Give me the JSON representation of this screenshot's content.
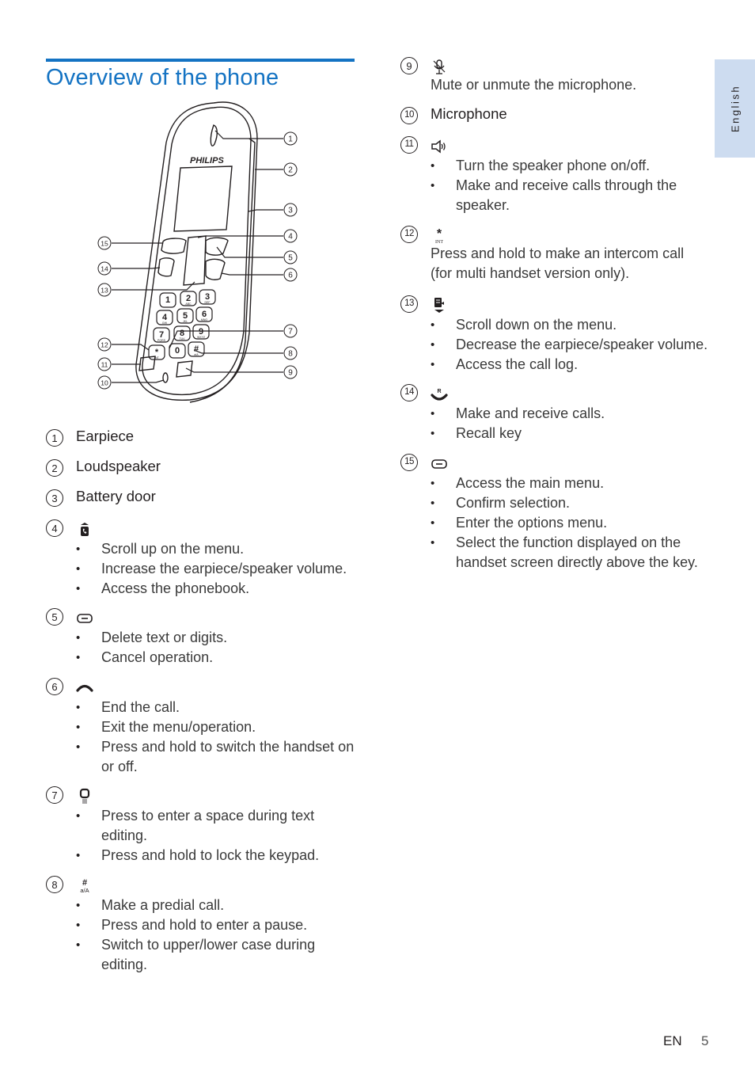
{
  "page": {
    "title": "Overview of the phone",
    "language_tab": "English",
    "footer_lang": "EN",
    "footer_page": "5",
    "accent_color": "#1473c3",
    "tab_color": "#cddcf0"
  },
  "diagram": {
    "brand": "PHILIPS",
    "callouts": [
      "1",
      "2",
      "3",
      "4",
      "5",
      "6",
      "7",
      "8",
      "9",
      "10",
      "11",
      "12",
      "13",
      "14",
      "15"
    ],
    "keypad": [
      {
        "digit": "1",
        "sub": ""
      },
      {
        "digit": "2",
        "sub": "ABC"
      },
      {
        "digit": "3",
        "sub": "DEF"
      },
      {
        "digit": "4",
        "sub": "GHI"
      },
      {
        "digit": "5",
        "sub": "JKL"
      },
      {
        "digit": "6",
        "sub": "MNO"
      },
      {
        "digit": "7",
        "sub": "PQRS"
      },
      {
        "digit": "8",
        "sub": "TUV"
      },
      {
        "digit": "9",
        "sub": "WXYZ"
      },
      {
        "digit": "*",
        "sub": "INT"
      },
      {
        "digit": "0",
        "sub": ""
      },
      {
        "digit": "#",
        "sub": "a/A"
      }
    ]
  },
  "items": [
    {
      "num": "1",
      "label": "Earpiece"
    },
    {
      "num": "2",
      "label": "Loudspeaker"
    },
    {
      "num": "3",
      "label": "Battery door"
    },
    {
      "num": "4",
      "icon": "scroll-up-phonebook-icon",
      "bullets": [
        "Scroll up on the menu.",
        "Increase the earpiece/speaker volume.",
        "Access the phonebook."
      ]
    },
    {
      "num": "5",
      "icon": "soft-key-icon",
      "bullets": [
        "Delete text or digits.",
        "Cancel operation."
      ]
    },
    {
      "num": "6",
      "icon": "end-call-icon",
      "bullets": [
        "End the call.",
        "Exit the menu/operation.",
        "Press and hold to switch the handset on or off."
      ]
    },
    {
      "num": "7",
      "icon": "zero-space-key-icon",
      "bullets": [
        "Press to enter a space during text editing.",
        "Press and hold to lock the keypad."
      ]
    },
    {
      "num": "8",
      "icon": "hash-key-icon",
      "icon_text": "#",
      "icon_sub": "a/A",
      "bullets": [
        "Make a predial call.",
        "Press and hold to enter a pause.",
        "Switch to upper/lower case during editing."
      ]
    },
    {
      "num": "9",
      "icon": "mute-mic-icon",
      "text": "Mute or unmute the microphone."
    },
    {
      "num": "10",
      "label": "Microphone"
    },
    {
      "num": "11",
      "icon": "speaker-icon",
      "bullets": [
        "Turn the speaker phone on/off.",
        "Make and receive calls through the speaker."
      ]
    },
    {
      "num": "12",
      "icon": "star-int-key-icon",
      "icon_text": "*",
      "icon_sub": "INT",
      "text": "Press and hold to make an intercom call (for multi handset version only)."
    },
    {
      "num": "13",
      "icon": "scroll-down-calllog-icon",
      "bullets": [
        "Scroll down on the menu.",
        "Decrease the earpiece/speaker volume.",
        "Access the call log."
      ]
    },
    {
      "num": "14",
      "icon": "talk-recall-icon",
      "icon_text": "R",
      "bullets": [
        "Make and receive calls.",
        "Recall key"
      ]
    },
    {
      "num": "15",
      "icon": "soft-key-icon",
      "bullets": [
        "Access the main menu.",
        "Confirm selection.",
        "Enter the options menu.",
        "Select the function displayed on the handset screen directly above the key."
      ]
    }
  ]
}
